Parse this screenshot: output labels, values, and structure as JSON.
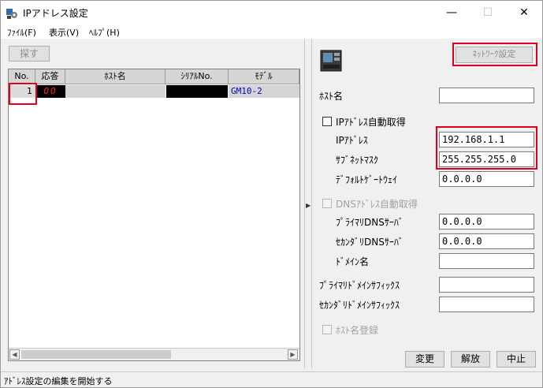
{
  "window": {
    "title": "IPアドレス設定",
    "minimize_glyph": "—",
    "maximize_glyph": "☐",
    "close_glyph": "✕"
  },
  "menu": {
    "items": [
      {
        "label": "ﾌｧｲﾙ(F)"
      },
      {
        "label": "表示(V)"
      },
      {
        "label": "ﾍﾙﾌﾟ(H)"
      }
    ]
  },
  "left": {
    "search_button": "探す",
    "columns": [
      "No.",
      "応答",
      "ﾎｽﾄ名",
      "ｼﾘｱﾙNo.",
      "ﾓﾃﾞﾙ"
    ],
    "rows": [
      {
        "no": "1",
        "response": "OO",
        "host": "",
        "serial": "",
        "model": "GM10-2"
      }
    ],
    "scroll_left": "◀",
    "scroll_right": "▶"
  },
  "splitter": {
    "arrow": "▶"
  },
  "right": {
    "network_settings_button": "ﾈｯﾄﾜｰｸ設定",
    "host_name_label": "ﾎｽﾄ名",
    "host_name_value": "",
    "ip_auto_label": "IPｱﾄﾞﾚｽ自動取得",
    "ip_auto_checked": false,
    "ip_address_label": "IPｱﾄﾞﾚｽ",
    "ip_address_value": "192.168.1.1",
    "subnet_label": "ｻﾌﾞﾈｯﾄﾏｽｸ",
    "subnet_value": "255.255.255.0",
    "gateway_label": "ﾃﾞﾌｫﾙﾄｹﾞｰﾄｳｪｲ",
    "gateway_value": "0.0.0.0",
    "dns_auto_label": "DNSｱﾄﾞﾚｽ自動取得",
    "primary_dns_label": "ﾌﾟﾗｲﾏﾘDNSｻｰﾊﾞ",
    "primary_dns_value": "0.0.0.0",
    "secondary_dns_label": "ｾｶﾝﾀﾞﾘDNSｻｰﾊﾞ",
    "secondary_dns_value": "0.0.0.0",
    "domain_label": "ﾄﾞﾒｲﾝ名",
    "domain_value": "",
    "primary_suffix_label": "ﾌﾟﾗｲﾏﾘﾄﾞﾒｲﾝｻﾌｨｯｸｽ",
    "primary_suffix_value": "",
    "secondary_suffix_label": "ｾｶﾝﾀﾞﾘﾄﾞﾒｲﾝｻﾌｨｯｸｽ",
    "secondary_suffix_value": "",
    "host_register_label": "ﾎｽﾄ名登録",
    "change_button": "変更",
    "release_button": "解放",
    "cancel_button": "中止"
  },
  "status": {
    "text": "ｱﾄﾞﾚｽ設定の編集を開始する"
  },
  "colors": {
    "highlight": "#e0001b",
    "response_text": "#ff2020",
    "model_text": "#0000c8"
  }
}
